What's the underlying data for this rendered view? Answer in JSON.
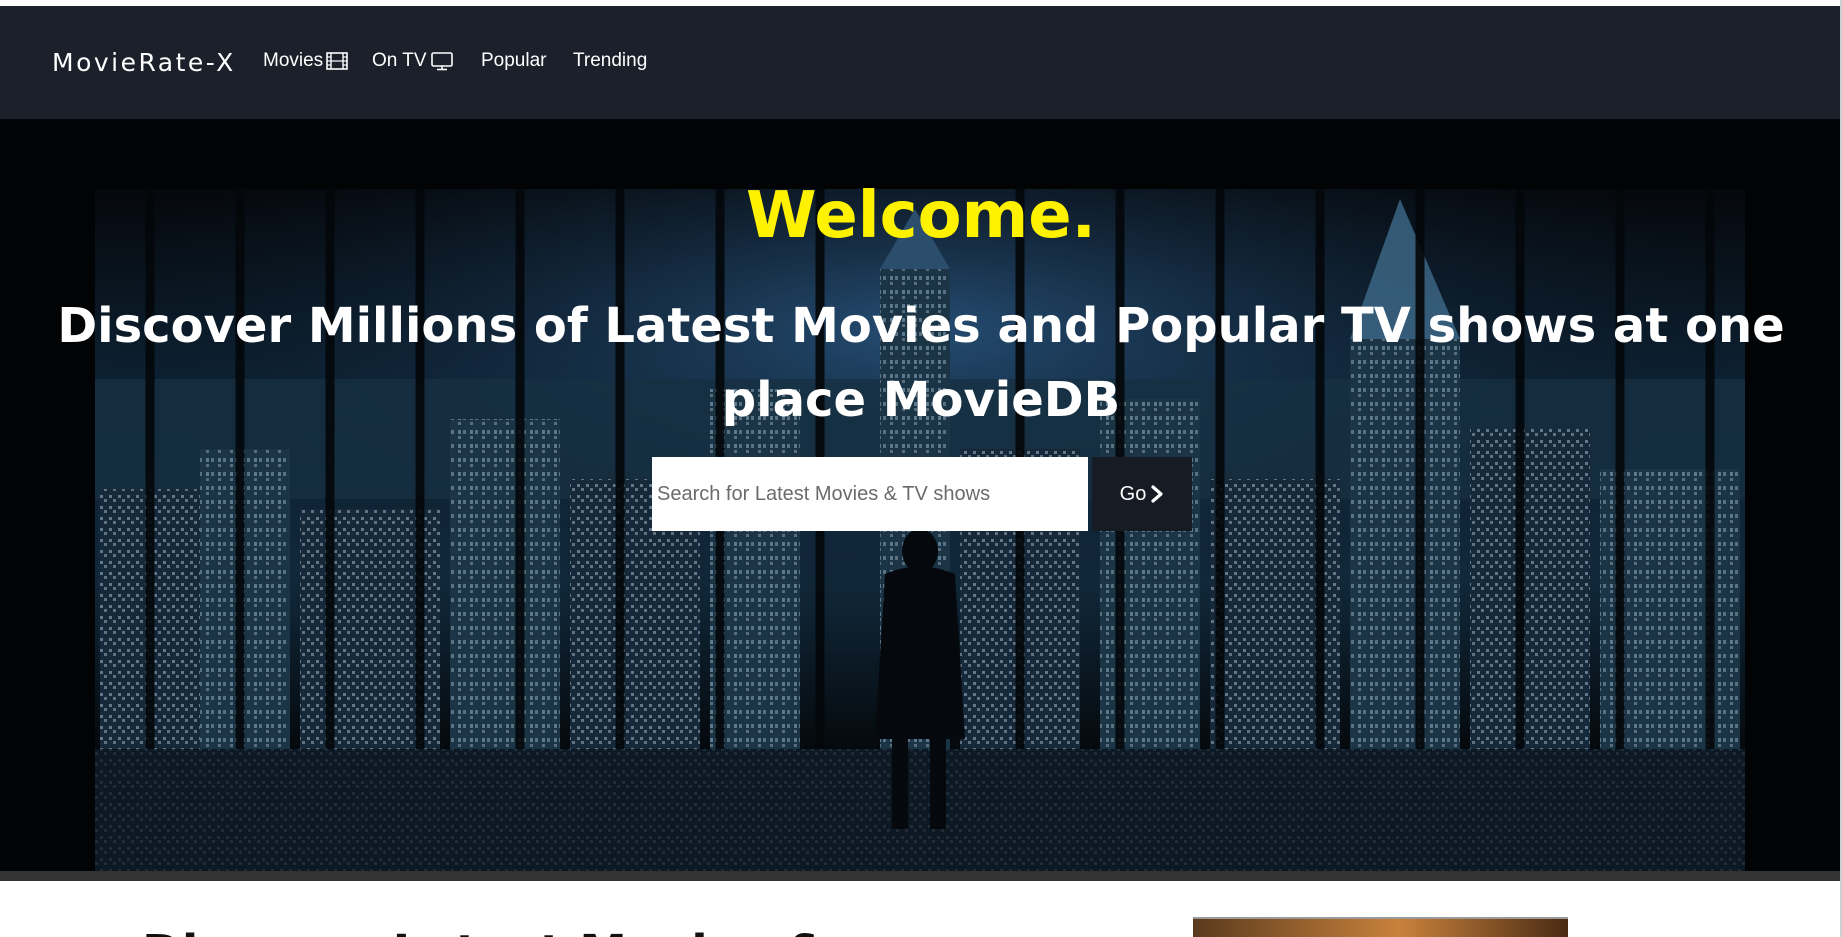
{
  "navbar": {
    "brand": "MovieRate-X",
    "items": [
      {
        "label": "Movies",
        "icon": "film-icon"
      },
      {
        "label": "On TV",
        "icon": "tv-icon"
      },
      {
        "label": "Popular"
      },
      {
        "label": "Trending"
      }
    ]
  },
  "hero": {
    "welcome": "Welcome.",
    "tagline": "Discover Millions of Latest Movies and Popular TV shows at one place MovieDB",
    "search": {
      "placeholder": "Search for Latest Movies & TV shows",
      "value": "",
      "button_label": "Go"
    }
  },
  "below": {
    "heading": "Discover Latest Movies & ..."
  },
  "colors": {
    "navbar_bg": "#1b202b",
    "welcome_text": "#fff200",
    "hero_bg": "#020304",
    "go_button_bg": "#171b24"
  }
}
